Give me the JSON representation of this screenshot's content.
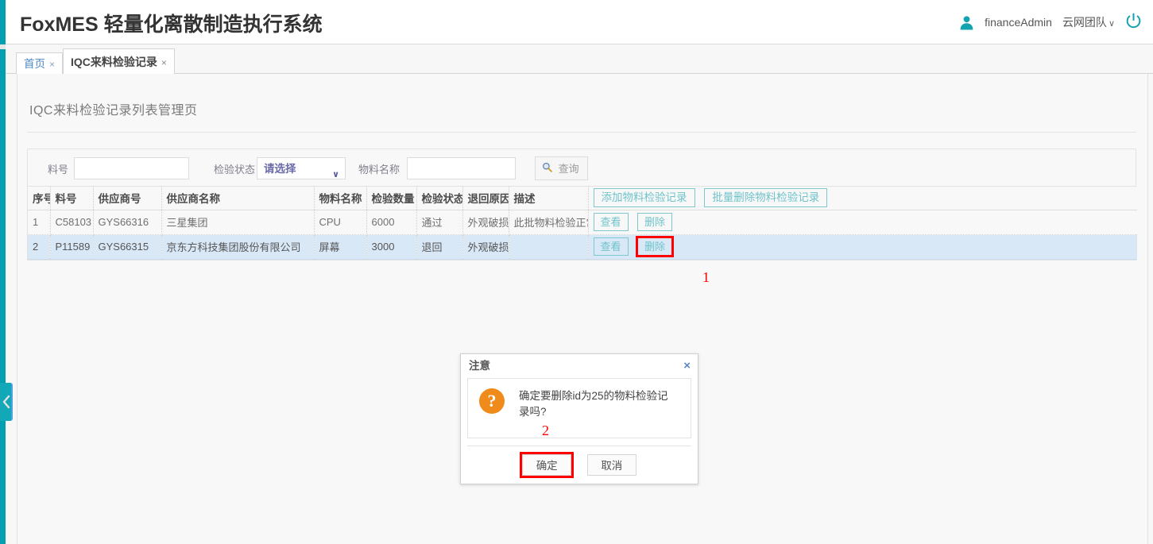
{
  "header": {
    "brand": "FoxMES 轻量化离散制造执行系统",
    "user_name": "financeAdmin",
    "team": "云网团队",
    "team_caret": "∨",
    "user_icon": "user-avatar-icon",
    "power_icon": "power-off-icon"
  },
  "tabs": [
    {
      "label": "首页",
      "close": "×",
      "active": false
    },
    {
      "label": "IQC来料检验记录",
      "close": "×",
      "active": true
    }
  ],
  "page": {
    "title": "IQC来料检验记录列表管理页"
  },
  "filters": {
    "material_no_label": "料号",
    "material_no_value": "",
    "material_no_placeholder": "",
    "status_label": "检验状态",
    "status_value": "请选择",
    "status_caret": "∨",
    "material_name_label": "物料名称",
    "material_name_value": "",
    "material_name_placeholder": "",
    "search_label": "查询",
    "search_icon": "magnifier-icon"
  },
  "table": {
    "columns": [
      "序号",
      "料号",
      "供应商号",
      "供应商名称",
      "物料名称",
      "检验数量",
      "检验状态",
      "退回原因",
      "描述"
    ],
    "toolbar": {
      "add_label": "添加物料检验记录",
      "batch_delete_label": "批量删除物料检验记录"
    },
    "row_actions": {
      "view_label": "查看",
      "delete_label": "删除"
    },
    "rows": [
      {
        "seq": "1",
        "material_no": "C58103",
        "supplier_no": "GYS66316",
        "supplier_name": "三星集团",
        "material_name": "CPU",
        "qty": "6000",
        "status": "通过",
        "return_reason": "外观破损",
        "description": "此批物料检验正常",
        "selected": false,
        "delete_highlighted": false
      },
      {
        "seq": "2",
        "material_no": "P11589",
        "supplier_no": "GYS66315",
        "supplier_name": "京东方科技集团股份有限公司",
        "material_name": "屏幕",
        "qty": "3000",
        "status": "退回",
        "return_reason": "外观破损",
        "description": "",
        "selected": true,
        "delete_highlighted": true
      }
    ]
  },
  "modal": {
    "title": "注意",
    "close": "×",
    "icon": "question-mark-icon",
    "message": "确定要删除id为25的物料检验记录吗?",
    "confirm_label": "确定",
    "cancel_label": "取消"
  },
  "annotations": [
    {
      "number": "1"
    },
    {
      "number": "2"
    }
  ],
  "colors": {
    "accent_teal": "#00a0b0",
    "button_teal": "#6fc3ca",
    "highlight_red": "#ff0000",
    "row_selected": "#d9e8f7",
    "question_orange": "#f08a1b"
  }
}
